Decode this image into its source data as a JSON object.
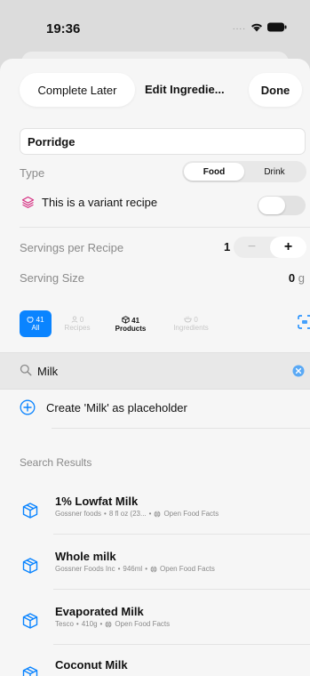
{
  "status_bar": {
    "time": "19:36",
    "dots": "....",
    "colors": {
      "wifi": "#111111",
      "battery": "#111111"
    }
  },
  "nav": {
    "complete_later": "Complete Later",
    "title": "Edit Ingredie...",
    "done": "Done"
  },
  "recipe": {
    "name": "Porridge",
    "type_label": "Type",
    "type_options": [
      "Food",
      "Drink"
    ],
    "type_selected": "Food",
    "variant_label": "This is a variant recipe",
    "variant_enabled": false,
    "servings_label": "Servings per Recipe",
    "servings_value": "1",
    "stepper_minus": "−",
    "stepper_plus": "+",
    "serving_size_label": "Serving Size",
    "serving_size_value": "0",
    "serving_size_unit": "g"
  },
  "filters": [
    {
      "icon": "apple-icon",
      "count": "41",
      "label": "All",
      "state": "active"
    },
    {
      "icon": "person-icon",
      "count": "0",
      "label": "Recipes",
      "state": "disabled"
    },
    {
      "icon": "box-icon",
      "count": "41",
      "label": "Products",
      "state": "bold"
    },
    {
      "icon": "bowl-icon",
      "count": "0",
      "label": "Ingredients",
      "state": "disabled"
    }
  ],
  "search": {
    "query": "Milk"
  },
  "create_placeholder": "Create 'Milk' as placeholder",
  "results_header": "Search Results",
  "results": [
    {
      "name": "1% Lowfat Milk",
      "brand": "Gossner foods",
      "size": "8 fl oz (23...",
      "source": "Open Food Facts"
    },
    {
      "name": "Whole milk",
      "brand": "Gossner Foods Inc",
      "size": "946ml",
      "source": "Open Food Facts"
    },
    {
      "name": "Evaporated Milk",
      "brand": "Tesco",
      "size": "410g",
      "source": "Open Food Facts"
    },
    {
      "name": "Coconut Milk",
      "brand": "",
      "size": "",
      "source": ""
    }
  ],
  "colors": {
    "accent": "#0a84ff",
    "variant_icon": "#d63384",
    "muted": "#8a8a8a"
  }
}
